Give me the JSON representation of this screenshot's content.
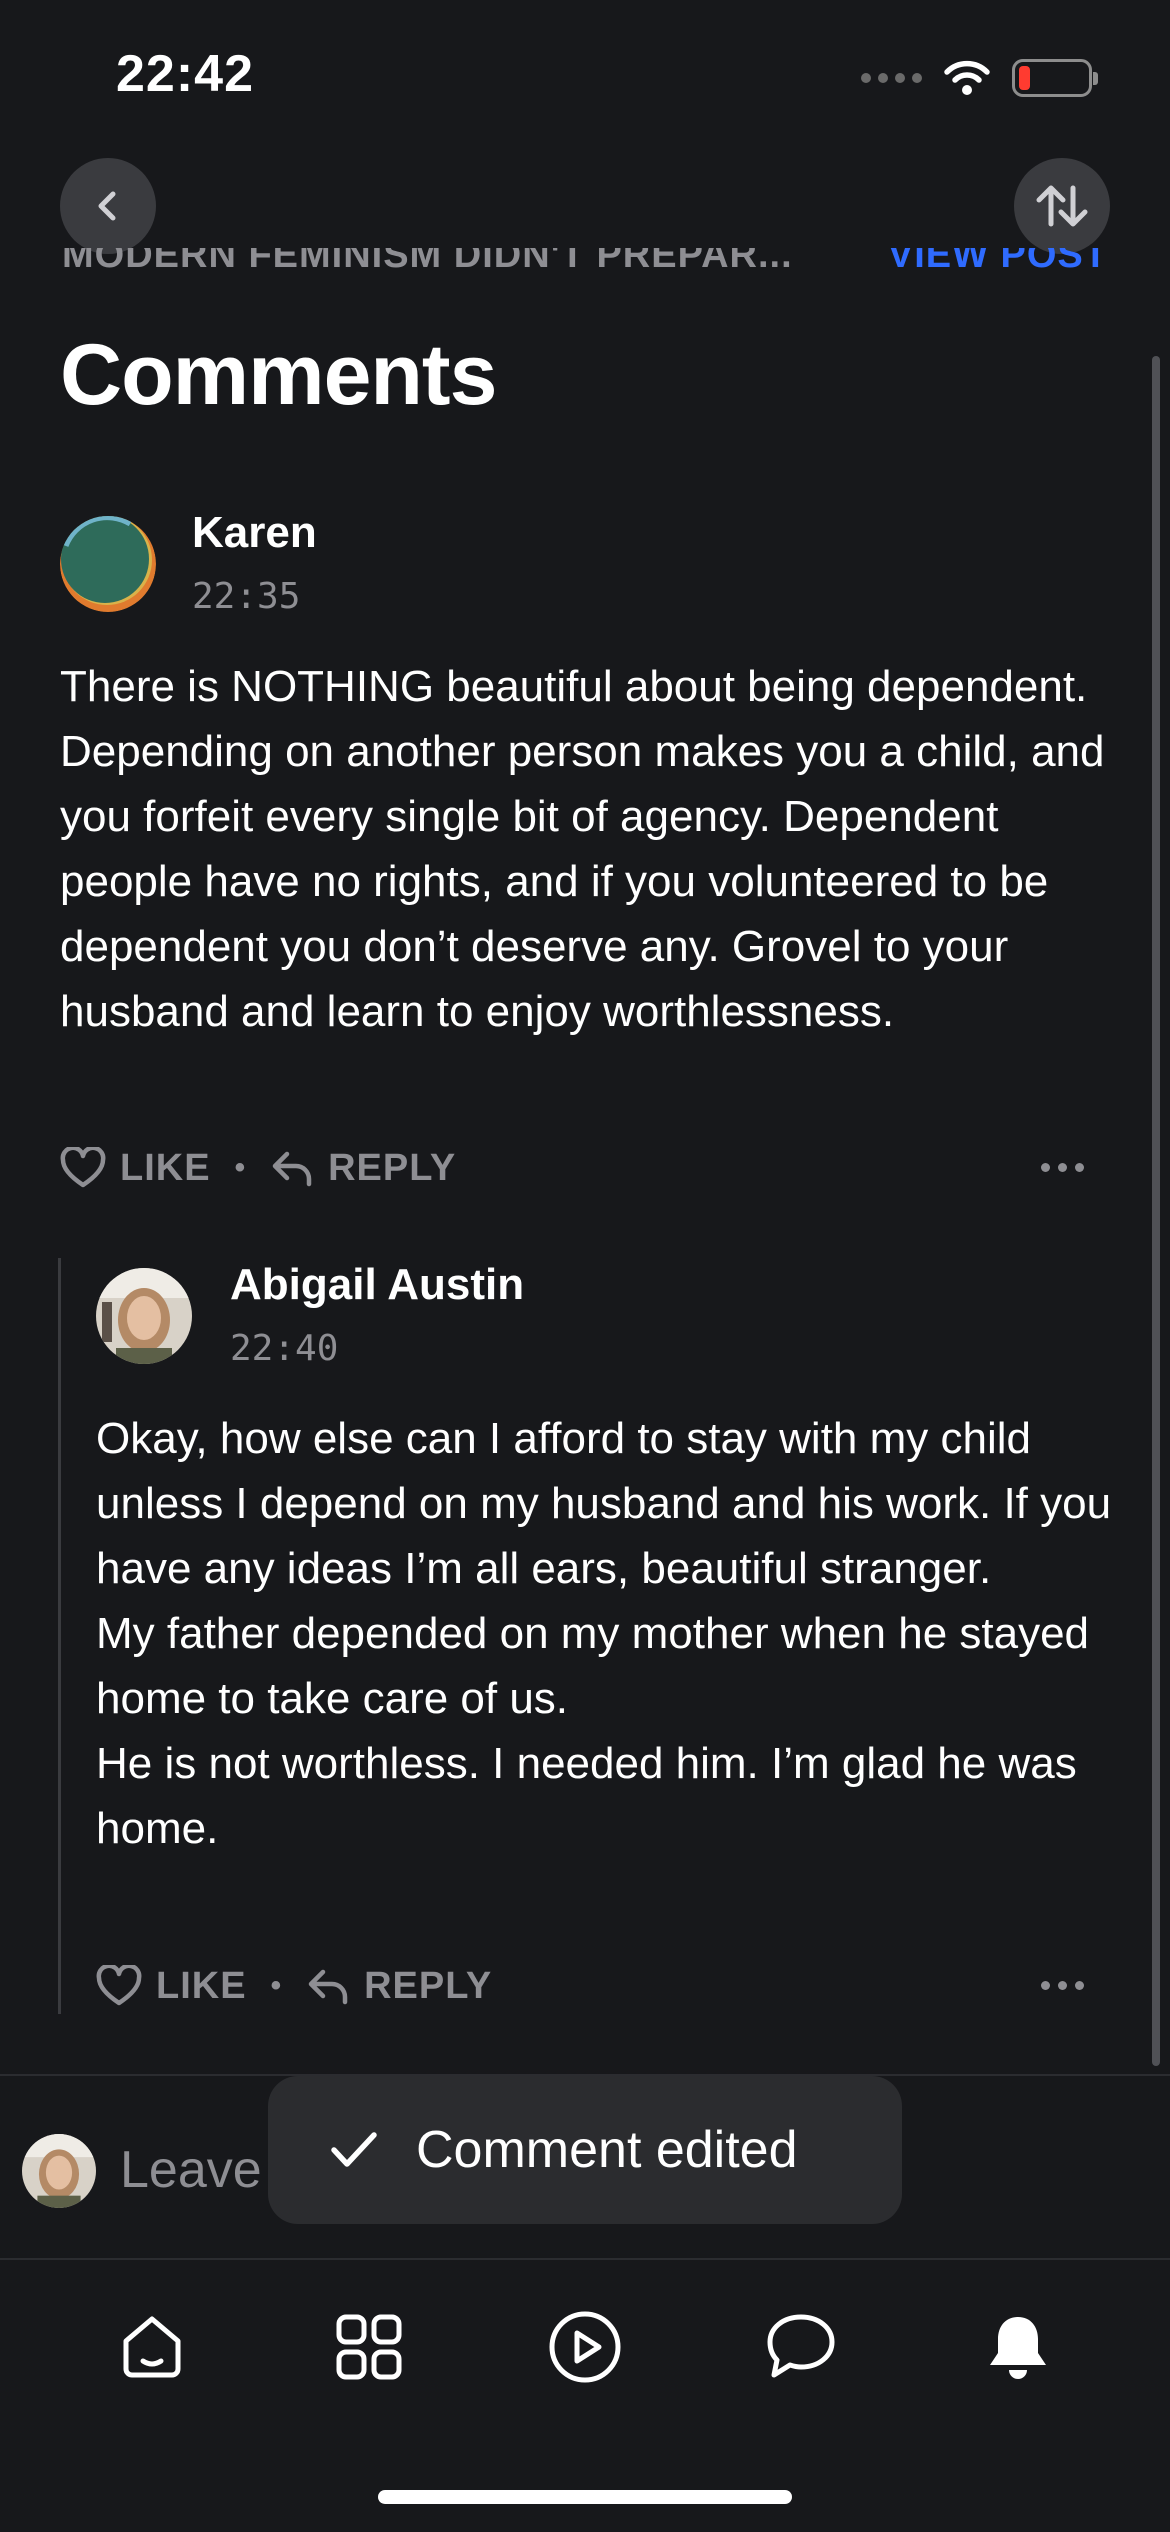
{
  "status_bar": {
    "time": "22:42"
  },
  "header": {
    "post_title": "MODERN FEMINISM DIDN'T PREPAR...",
    "view_post_label": "VIEW POST",
    "page_title": "Comments"
  },
  "comments": [
    {
      "author": "Karen",
      "time": "22:35",
      "body": [
        "There is NOTHING beautiful about being dependent.  Depending on another person makes you a child, and you forfeit every single bit of agency.  Dependent people have no rights, and if you volunteered to be dependent you don’t deserve any.  Grovel to your husband and learn to enjoy worthlessness."
      ],
      "like_label": "LIKE",
      "reply_label": "REPLY"
    },
    {
      "author": "Abigail Austin",
      "time": "22:40",
      "body": [
        "Okay, how else can I afford to stay with my child unless I depend on my husband and his work. If you have any ideas I’m all ears, beautiful stranger.",
        "My father depended on my mother when he stayed home to take care of us.",
        "He is not worthless. I needed him. I’m glad he was home."
      ],
      "like_label": "LIKE",
      "reply_label": "REPLY"
    }
  ],
  "compose": {
    "placeholder": "Leave"
  },
  "toast": {
    "message": "Comment edited"
  },
  "tabbar": {
    "icons": [
      "home-icon",
      "grid-icon",
      "play-icon",
      "chat-icon",
      "bell-icon"
    ]
  },
  "colors": {
    "background": "#17181b",
    "accent": "#2f6bff",
    "muted": "#8e8e93",
    "battery_low": "#ff3b30"
  }
}
